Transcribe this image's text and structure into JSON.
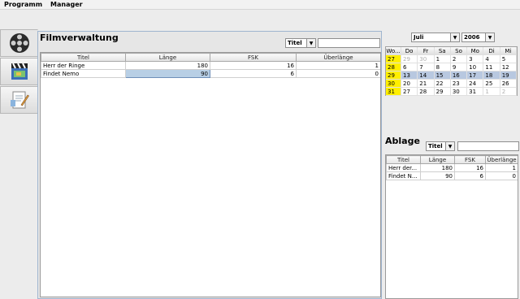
{
  "menu": [
    "Programm",
    "Manager"
  ],
  "main": {
    "title": "Filmverwaltung",
    "filter_combo": "Titel",
    "search_value": "",
    "columns": [
      "Titel",
      "Länge",
      "FSK",
      "Überlänge"
    ],
    "rows": [
      [
        "Herr der Ringe",
        "180",
        "16",
        "1"
      ],
      [
        "Findet Nemo",
        "90",
        "6",
        "0"
      ]
    ]
  },
  "calendar": {
    "month": "Juli",
    "year": "2006",
    "headers": [
      "Wo...",
      "Do",
      "Fr",
      "Sa",
      "So",
      "Mo",
      "Di",
      "Mi"
    ],
    "weeks": [
      [
        "27",
        "29",
        "30",
        "1",
        "2",
        "3",
        "4",
        "5"
      ],
      [
        "28",
        "6",
        "7",
        "8",
        "9",
        "10",
        "11",
        "12"
      ],
      [
        "29",
        "13",
        "14",
        "15",
        "16",
        "17",
        "18",
        "19"
      ],
      [
        "30",
        "20",
        "21",
        "22",
        "23",
        "24",
        "25",
        "26"
      ],
      [
        "31",
        "27",
        "28",
        "29",
        "30",
        "31",
        "1",
        "2"
      ]
    ]
  },
  "ablage": {
    "title": "Ablage",
    "filter_combo": "Titel",
    "search_value": "",
    "columns": [
      "Titel",
      "Länge",
      "FSK",
      "Überlänge"
    ],
    "rows": [
      [
        "Herr der...",
        "180",
        "16",
        "1"
      ],
      [
        "Findet N...",
        "90",
        "6",
        "0"
      ]
    ]
  },
  "icons": [
    "film-reel-icon",
    "clapperboard-icon",
    "notebook-icon"
  ],
  "colors": {
    "week_highlight": "#ffef00",
    "selection": "#b8cfe5",
    "panel_border": "#9fb5cf"
  }
}
